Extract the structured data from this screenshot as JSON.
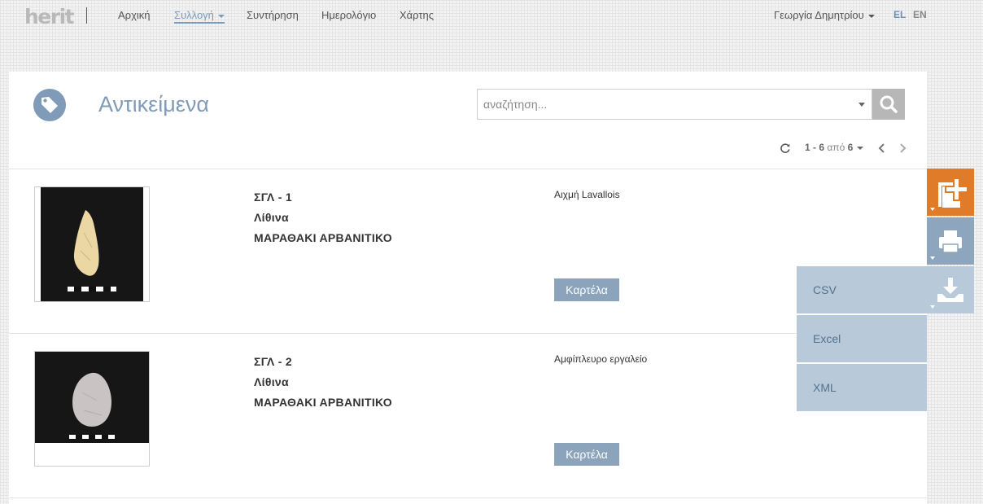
{
  "nav": {
    "logo": "herit",
    "items": [
      {
        "label": "Αρχική"
      },
      {
        "label": "Συλλογή"
      },
      {
        "label": "Συντήρηση"
      },
      {
        "label": "Ημερολόγιο"
      },
      {
        "label": "Χάρτης"
      }
    ],
    "user": "Γεωργία Δημητρίου",
    "lang_el": "EL",
    "lang_en": "EN"
  },
  "page": {
    "title": "Αντικείμενα",
    "search_placeholder": "αναζήτηση..."
  },
  "pager": {
    "range": "1 - 6",
    "of": "από",
    "total": "6"
  },
  "items": [
    {
      "code": "ΣΓΛ - 1",
      "category": "Λίθινα",
      "site": "ΜΑΡΑΘΑΚΙ ΑΡΒΑΝΙΤΙΚΟ",
      "description": "Αιχμή Lavallois",
      "button": "Καρτέλα"
    },
    {
      "code": "ΣΓΛ - 2",
      "category": "Λίθινα",
      "site": "ΜΑΡΑΘΑΚΙ ΑΡΒΑΝΙΤΙΚΟ",
      "description": "Αμφίπλευρο εργαλείο",
      "button": "Καρτέλα"
    }
  ],
  "export_menu": {
    "csv": "CSV",
    "excel": "Excel",
    "xml": "XML"
  },
  "colors": {
    "accent": "#7a9cc0",
    "add_button": "#e07b2a",
    "print_button": "#8ea6bd",
    "export_button": "#b8cad9",
    "card_button": "#8ba3bb"
  },
  "icons": {
    "title": "tag-icon",
    "search": "search-icon",
    "refresh": "refresh-icon",
    "add": "add-icon",
    "print": "print-icon",
    "export": "download-icon"
  }
}
